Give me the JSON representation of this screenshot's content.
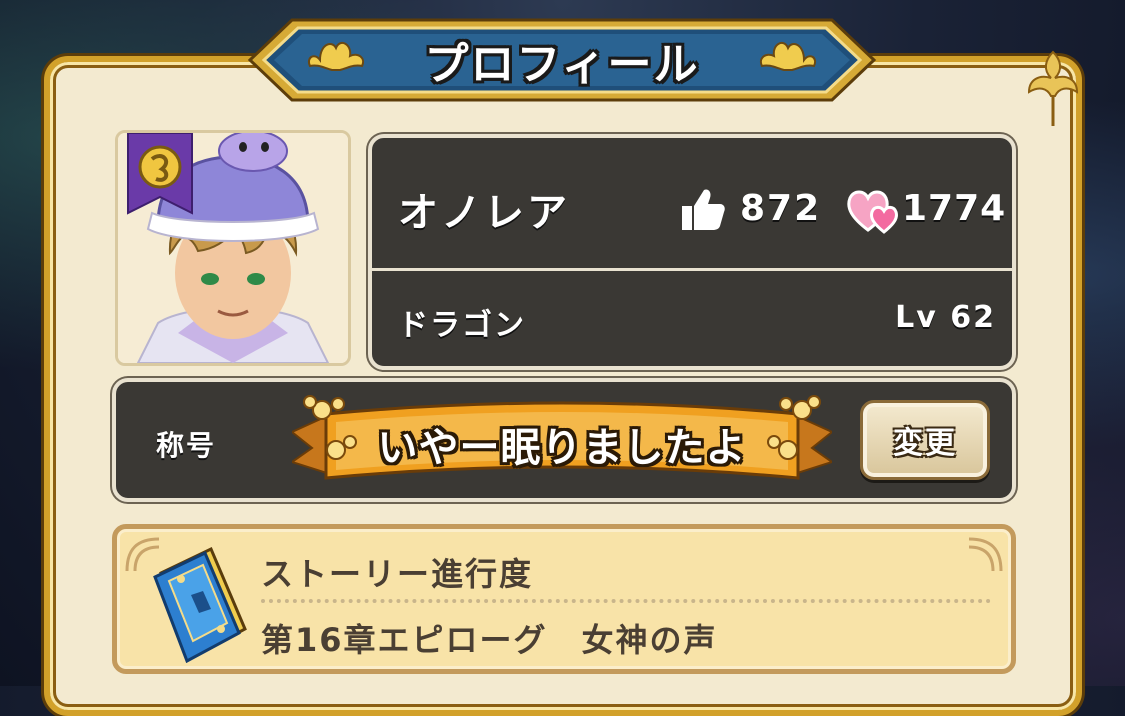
{
  "screen": {
    "title": "プロフィール"
  },
  "profile": {
    "name": "オノレア",
    "likes": "872",
    "hearts": "1774",
    "job": "ドラゴン",
    "level": "Lv 62"
  },
  "title_section": {
    "label": "称号",
    "current_title": "いやー眠りましたよ",
    "change_button": "変更"
  },
  "story": {
    "heading": "ストーリー進行度",
    "progress": "第16章エピローグ　女神の声"
  },
  "icons": {
    "likes": "thumbs-up-icon",
    "hearts": "double-heart-icon",
    "job": "dragon-job-emblem-icon",
    "story": "story-book-icon"
  },
  "colors": {
    "panel": "#f3ead0",
    "frame_gold": "#d2a12a",
    "banner_blue": "#1f4f7a",
    "dark_box": "#3a3834",
    "ribbon_orange": "#f0a020",
    "story_box": "#f8e3a8",
    "heart_pink": "#f36aa0"
  }
}
